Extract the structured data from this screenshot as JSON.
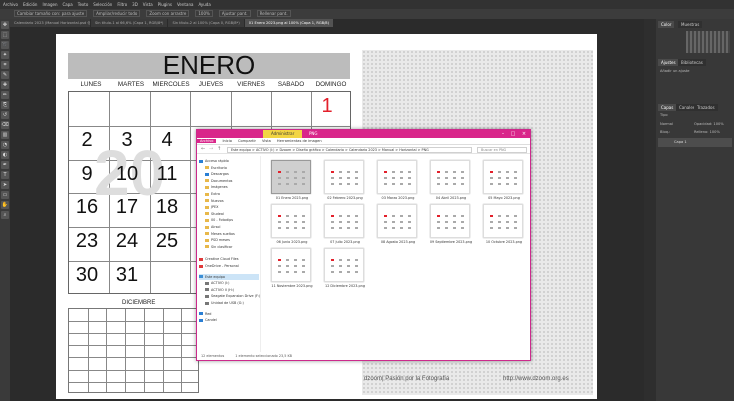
{
  "photoshop": {
    "menu": [
      "Archivo",
      "Edición",
      "Imagen",
      "Capa",
      "Texto",
      "Selección",
      "Filtro",
      "3D",
      "Vista",
      "Plugins",
      "Ventana",
      "Ayuda"
    ],
    "options": [
      "Cambiar tamaño con: para ajuste",
      "Ampliar/reducir todo",
      "Zoom con arrastre",
      "100%",
      "Ajustar pant.",
      "Rellenar pant."
    ],
    "doc_tabs": [
      {
        "label": "Calendario 2023 (Manual Horizontal.psd @ 100% (Fotografía, RGB/8*) *",
        "active": false
      },
      {
        "label": "Sin título-1 al 66,6% (Capa 1, RGB/8*)",
        "active": false
      },
      {
        "label": "Sin título-2 al 100% (Capa 0, RGB/8*)",
        "active": false
      },
      {
        "label": "01 Enero 2023.png al 100% (Capa 1, RGB/8)",
        "active": true
      }
    ],
    "panel_tabs": [
      "Color",
      "Muestras",
      "Ajustes",
      "Bibliotecas",
      "Capas",
      "Canales",
      "Trazados"
    ],
    "layers_labels": {
      "filter": "Tipo",
      "mode": "Normal",
      "opacity": "Opacidad: 100%",
      "lock": "Bloq.:",
      "fill": "Relleno: 100%",
      "add_adjust": "Añadir un ajuste"
    },
    "layers": [
      "Capa 1"
    ],
    "colors": {
      "accent": "#d9268a",
      "red_day": "#e3202b",
      "manage": "#f2d544"
    }
  },
  "calendar": {
    "month": "ENERO",
    "weekdays": [
      "LUNES",
      "MARTES",
      "MIERCOLES",
      "JUEVES",
      "VIERNES",
      "SABADO",
      "DOMINGO"
    ],
    "watermark": "20",
    "days": [
      {
        "v": "1",
        "c": 6,
        "r": 0,
        "red": true
      },
      {
        "v": "2",
        "c": 0,
        "r": 1
      },
      {
        "v": "3",
        "c": 1,
        "r": 1
      },
      {
        "v": "4",
        "c": 2,
        "r": 1
      },
      {
        "v": "9",
        "c": 0,
        "r": 2
      },
      {
        "v": "10",
        "c": 1,
        "r": 2
      },
      {
        "v": "11",
        "c": 2,
        "r": 2
      },
      {
        "v": "16",
        "c": 0,
        "r": 3
      },
      {
        "v": "17",
        "c": 1,
        "r": 3
      },
      {
        "v": "18",
        "c": 2,
        "r": 3
      },
      {
        "v": "23",
        "c": 0,
        "r": 4
      },
      {
        "v": "24",
        "c": 1,
        "r": 4
      },
      {
        "v": "25",
        "c": 2,
        "r": 4
      },
      {
        "v": "30",
        "c": 0,
        "r": 5
      },
      {
        "v": "31",
        "c": 1,
        "r": 5
      }
    ],
    "next_month": "DICIEMBRE",
    "footer_left": "dzoom| Pasión por la Fotografía",
    "footer_right": "http://www.dzoom.org.es"
  },
  "explorer": {
    "manage_tab": "Administrar",
    "folder_name": "PNG",
    "ribbon": [
      "Archivo",
      "Inicio",
      "Compartir",
      "Vista",
      "Herramientas de imagen"
    ],
    "address": "Este equipo > ACTIVO (I:) > Dzoom > Diseño gráfico > Calendario > Calendario 2023 > Manual > Horizontal > PNG",
    "search_placeholder": "Buscar en PNG",
    "nav": [
      {
        "label": "Acceso rápido",
        "type": "star"
      },
      {
        "label": "Escritorio",
        "type": "folder"
      },
      {
        "label": "Descargas",
        "type": "down"
      },
      {
        "label": "Documentos",
        "type": "folder"
      },
      {
        "label": "Imágenes",
        "type": "folder"
      },
      {
        "label": "Extra",
        "type": "folder"
      },
      {
        "label": "Nuevos",
        "type": "folder"
      },
      {
        "label": "JPEX",
        "type": "folder"
      },
      {
        "label": "Studeal",
        "type": "folder"
      },
      {
        "label": "00 - Fotodips",
        "type": "folder"
      },
      {
        "label": "Airsol",
        "type": "folder"
      },
      {
        "label": "Meses sueltos",
        "type": "folder"
      },
      {
        "label": "PSD meses",
        "type": "folder"
      },
      {
        "label": "Sin clasificar",
        "type": "folder"
      },
      {
        "label": "Creative Cloud Files",
        "type": "cloud"
      },
      {
        "label": "OneDrive - Personal",
        "type": "cloud"
      },
      {
        "label": "Este equipo",
        "type": "pc",
        "sel": true
      },
      {
        "label": "ACTIVO (I:)",
        "type": "drive"
      },
      {
        "label": "ACTIVO II (H:)",
        "type": "drive"
      },
      {
        "label": "Seagate Expansion Drive (F:)",
        "type": "drive"
      },
      {
        "label": "Unidad de USB (G:)",
        "type": "drive"
      },
      {
        "label": "Red",
        "type": "net"
      },
      {
        "label": "Candel",
        "type": "net"
      }
    ],
    "files": [
      {
        "name": "01 Enero 2023.png",
        "sel": true
      },
      {
        "name": "02 Febrero 2023.png"
      },
      {
        "name": "03 Marzo 2023.png"
      },
      {
        "name": "04 Abril 2023.png"
      },
      {
        "name": "05 Mayo 2023.png"
      },
      {
        "name": "06 Junio 2023.png"
      },
      {
        "name": "07 Julio 2023.png"
      },
      {
        "name": "08 Agosto 2023.png"
      },
      {
        "name": "09 Septiembre 2023.png"
      },
      {
        "name": "10 Octubre 2023.png"
      },
      {
        "name": "11 Noviembre 2023.png"
      },
      {
        "name": "12 Diciembre 2023.png"
      }
    ],
    "status_count": "12 elementos",
    "status_selected": "1 elemento seleccionado 23,5 KB"
  }
}
